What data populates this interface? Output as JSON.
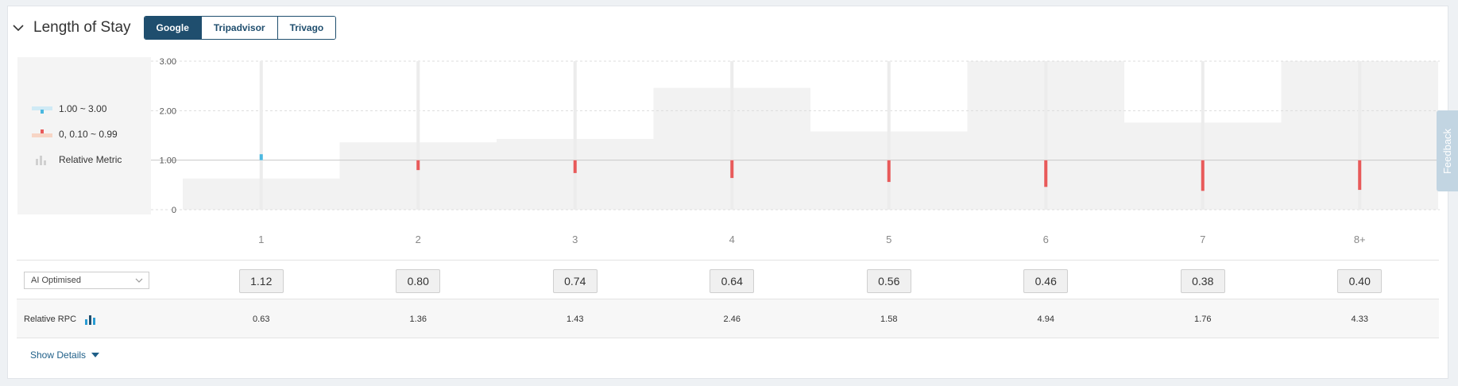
{
  "header": {
    "title": "Length of Stay",
    "tabs": [
      {
        "label": "Google",
        "active": true
      },
      {
        "label": "Tripadvisor",
        "active": false
      },
      {
        "label": "Trivago",
        "active": false
      }
    ]
  },
  "legend": {
    "items": [
      {
        "label": "1.00 ~ 3.00",
        "icon": "blue-range-swatch"
      },
      {
        "label": "0, 0.10 ~ 0.99",
        "icon": "red-range-swatch"
      },
      {
        "label": "Relative Metric",
        "icon": "bar-chart-icon"
      }
    ]
  },
  "colors": {
    "accent": "#1f4e6e",
    "above_one": "#4bb8e0",
    "below_one": "#e85a5a",
    "relative_band": "#f2f2f2"
  },
  "chart_data": {
    "type": "bar",
    "categories": [
      "1",
      "2",
      "3",
      "4",
      "5",
      "6",
      "7",
      "8+"
    ],
    "y_ticks": [
      "3.00",
      "2.00",
      "1.00",
      "0"
    ],
    "ylim": [
      0,
      3
    ],
    "baseline": 1.0,
    "grid": true,
    "series": [
      {
        "values": [
          1.12,
          0.8,
          0.74,
          0.64,
          0.56,
          0.46,
          0.38,
          0.4
        ]
      },
      {
        "values": [
          0.63,
          1.36,
          1.43,
          2.46,
          1.58,
          4.94,
          1.76,
          4.33
        ]
      }
    ]
  },
  "settings_row": {
    "dropdown_value": "AI Optimised",
    "values": [
      "1.12",
      "0.80",
      "0.74",
      "0.64",
      "0.56",
      "0.46",
      "0.38",
      "0.40"
    ]
  },
  "rpc_row": {
    "label": "Relative RPC",
    "values": [
      "0.63",
      "1.36",
      "1.43",
      "2.46",
      "1.58",
      "4.94",
      "1.76",
      "4.33"
    ]
  },
  "footer": {
    "show_details": "Show Details"
  },
  "feedback": {
    "label": "Feedback"
  }
}
